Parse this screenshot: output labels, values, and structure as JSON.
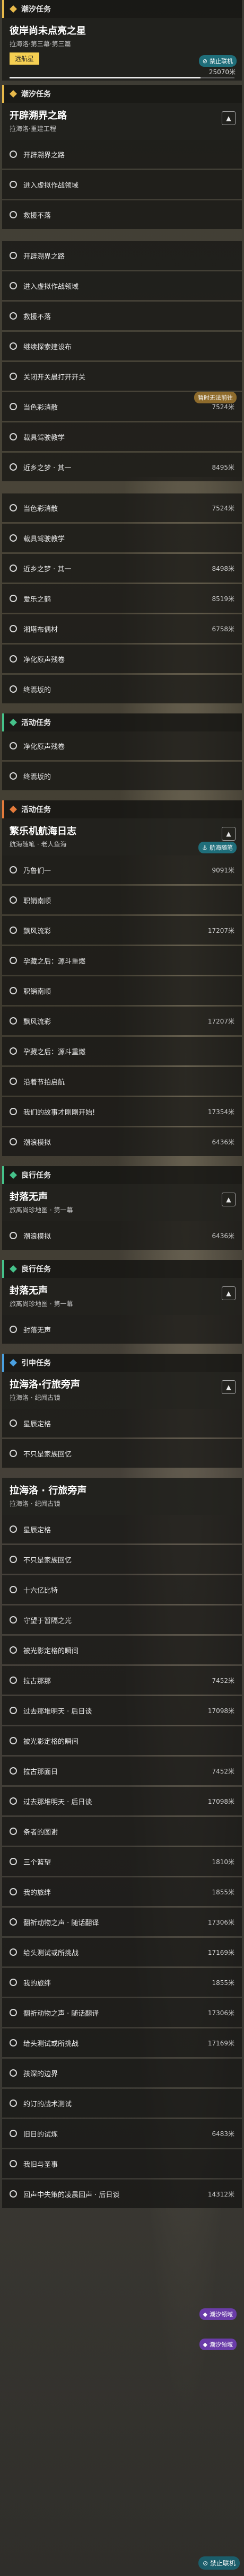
{
  "header": {
    "title": "潮汐任务"
  },
  "quest1": {
    "title": "彼岸尚未点亮之星",
    "sub": "拉海洛·第三幕·第三篇",
    "action": "远航星",
    "badge": "禁止联机",
    "dist": "25070米"
  },
  "quest1_progress": 0.85,
  "group_main": {
    "title": "潮汐任务"
  },
  "quest2": {
    "title": "开辟溯界之路",
    "sub": "拉海洛·重建工程"
  },
  "q2_items": [
    "开辟溯界之路",
    "进入虚拟作战领域",
    "救援不落"
  ],
  "items_block1": [
    {
      "label": "开辟溯界之路",
      "dist": ""
    },
    {
      "label": "进入虚拟作战领域",
      "dist": ""
    },
    {
      "label": "救援不落",
      "dist": ""
    },
    {
      "label": "继续探索建设布",
      "dist": ""
    },
    {
      "label": "关闭开关晨打开开关",
      "dist": ""
    },
    {
      "label": "当色彩消散",
      "dist": "7524米"
    },
    {
      "label": "载具驾驶教学",
      "dist": ""
    },
    {
      "label": "近乡之梦 · 其一",
      "dist": "8495米"
    }
  ],
  "badge_mid": "暂时无法前往",
  "items_block2": [
    {
      "label": "当色彩消散",
      "dist": "7524米"
    },
    {
      "label": "载具驾驶教学",
      "dist": ""
    },
    {
      "label": "近乡之梦 · 其一",
      "dist": "8498米"
    },
    {
      "label": "爱乐之鹤",
      "dist": "8519米"
    },
    {
      "label": "湘塔布偶材",
      "dist": "6758米"
    },
    {
      "label": "净化原声残卷",
      "dist": ""
    },
    {
      "label": "终焉坂的",
      "dist": ""
    }
  ],
  "group_activity": {
    "title": "活动任务"
  },
  "items_block3": [
    {
      "label": "净化原声残卷",
      "dist": ""
    },
    {
      "label": "终焉坂的",
      "dist": ""
    }
  ],
  "group_event": {
    "title": "活动任务"
  },
  "quest3": {
    "title": "繁乐机航海日志",
    "sub": "航海随笔 · 老人鱼海",
    "badge": "航海随笔"
  },
  "items_block4": [
    {
      "label": "乃鲁们一",
      "dist": "9091米"
    },
    {
      "label": "职销南顺",
      "dist": ""
    },
    {
      "label": "飘风流彩",
      "dist": "17207米"
    },
    {
      "label": "孕藏之后：源斗重燃",
      "dist": ""
    },
    {
      "label": "职销南顺",
      "dist": ""
    },
    {
      "label": "飘风流彩",
      "dist": "17207米"
    },
    {
      "label": "孕藏之后：源斗重燃",
      "dist": ""
    },
    {
      "label": "沿着节拍启航",
      "dist": ""
    },
    {
      "label": "我们的故事才刚刚开始!",
      "dist": "17354米"
    },
    {
      "label": "潮浪模拟",
      "dist": "6436米"
    }
  ],
  "group_side": {
    "title": "良行任务"
  },
  "quest4": {
    "title": "封落无声",
    "sub": "旅离尚珍地图 · 第一幕"
  },
  "items_block5": [
    {
      "label": "潮浪模拟",
      "dist": "6436米"
    }
  ],
  "group_side2": {
    "title": "良行任务"
  },
  "quest5": {
    "title": "封落无声",
    "sub": "旅离尚珍地图 · 第一幕"
  },
  "items_block6": [
    {
      "label": "封落无声",
      "dist": ""
    }
  ],
  "group_assoc": {
    "title": "引申任务"
  },
  "quest6": {
    "title": "拉海洛·行旅旁声",
    "sub": "拉海洛 · 纪闻古镜"
  },
  "items_block7": [
    {
      "label": "星辰定格",
      "dist": ""
    },
    {
      "label": "不只是家族回忆",
      "dist": ""
    }
  ],
  "quest7": {
    "title": "拉海洛 · 行旅旁声",
    "sub": "拉海洛 · 纪闻古镜"
  },
  "items_block8": [
    {
      "label": "星辰定格",
      "dist": ""
    },
    {
      "label": "不只是家族回忆",
      "dist": ""
    },
    {
      "label": "十六亿比特",
      "dist": ""
    },
    {
      "label": "守望于暂隔之光",
      "dist": ""
    },
    {
      "label": "被光影定格的瞬间",
      "dist": ""
    },
    {
      "label": "拉古那那",
      "dist": "7452米"
    },
    {
      "label": "过去那堆明天 · 后日谈",
      "dist": "17098米"
    },
    {
      "label": "被光影定格的瞬间",
      "dist": ""
    },
    {
      "label": "拉古那面日",
      "dist": "7452米"
    },
    {
      "label": "过去那堆明天 · 后日谈",
      "dist": "17098米"
    },
    {
      "label": "条者的图谢",
      "dist": ""
    },
    {
      "label": "三个篮望",
      "dist": "1810米"
    },
    {
      "label": "我的旅绊",
      "dist": "1855米"
    },
    {
      "label": "翻祈动物之声 · 随话翻译",
      "dist": "17306米"
    },
    {
      "label": "给头测试或所挑战",
      "dist": "17169米"
    },
    {
      "label": "我的旅绊",
      "dist": "1855米"
    },
    {
      "label": "翻祈动物之声 · 随话翻译",
      "dist": "17306米"
    },
    {
      "label": "给头测试或所挑战",
      "dist": "17169米"
    },
    {
      "label": "孩深的边界",
      "dist": ""
    },
    {
      "label": "约订的战术测试",
      "dist": ""
    },
    {
      "label": "旧日的试炼",
      "dist": "6483米"
    },
    {
      "label": "我旧与圣事",
      "dist": ""
    },
    {
      "label": "回声中失策的凌晨回声 · 后日谈",
      "dist": "14312米"
    }
  ],
  "badge_tide1": "潮汐领域",
  "badge_tide2": "潮汐领域",
  "footer_badge": "禁止联机"
}
